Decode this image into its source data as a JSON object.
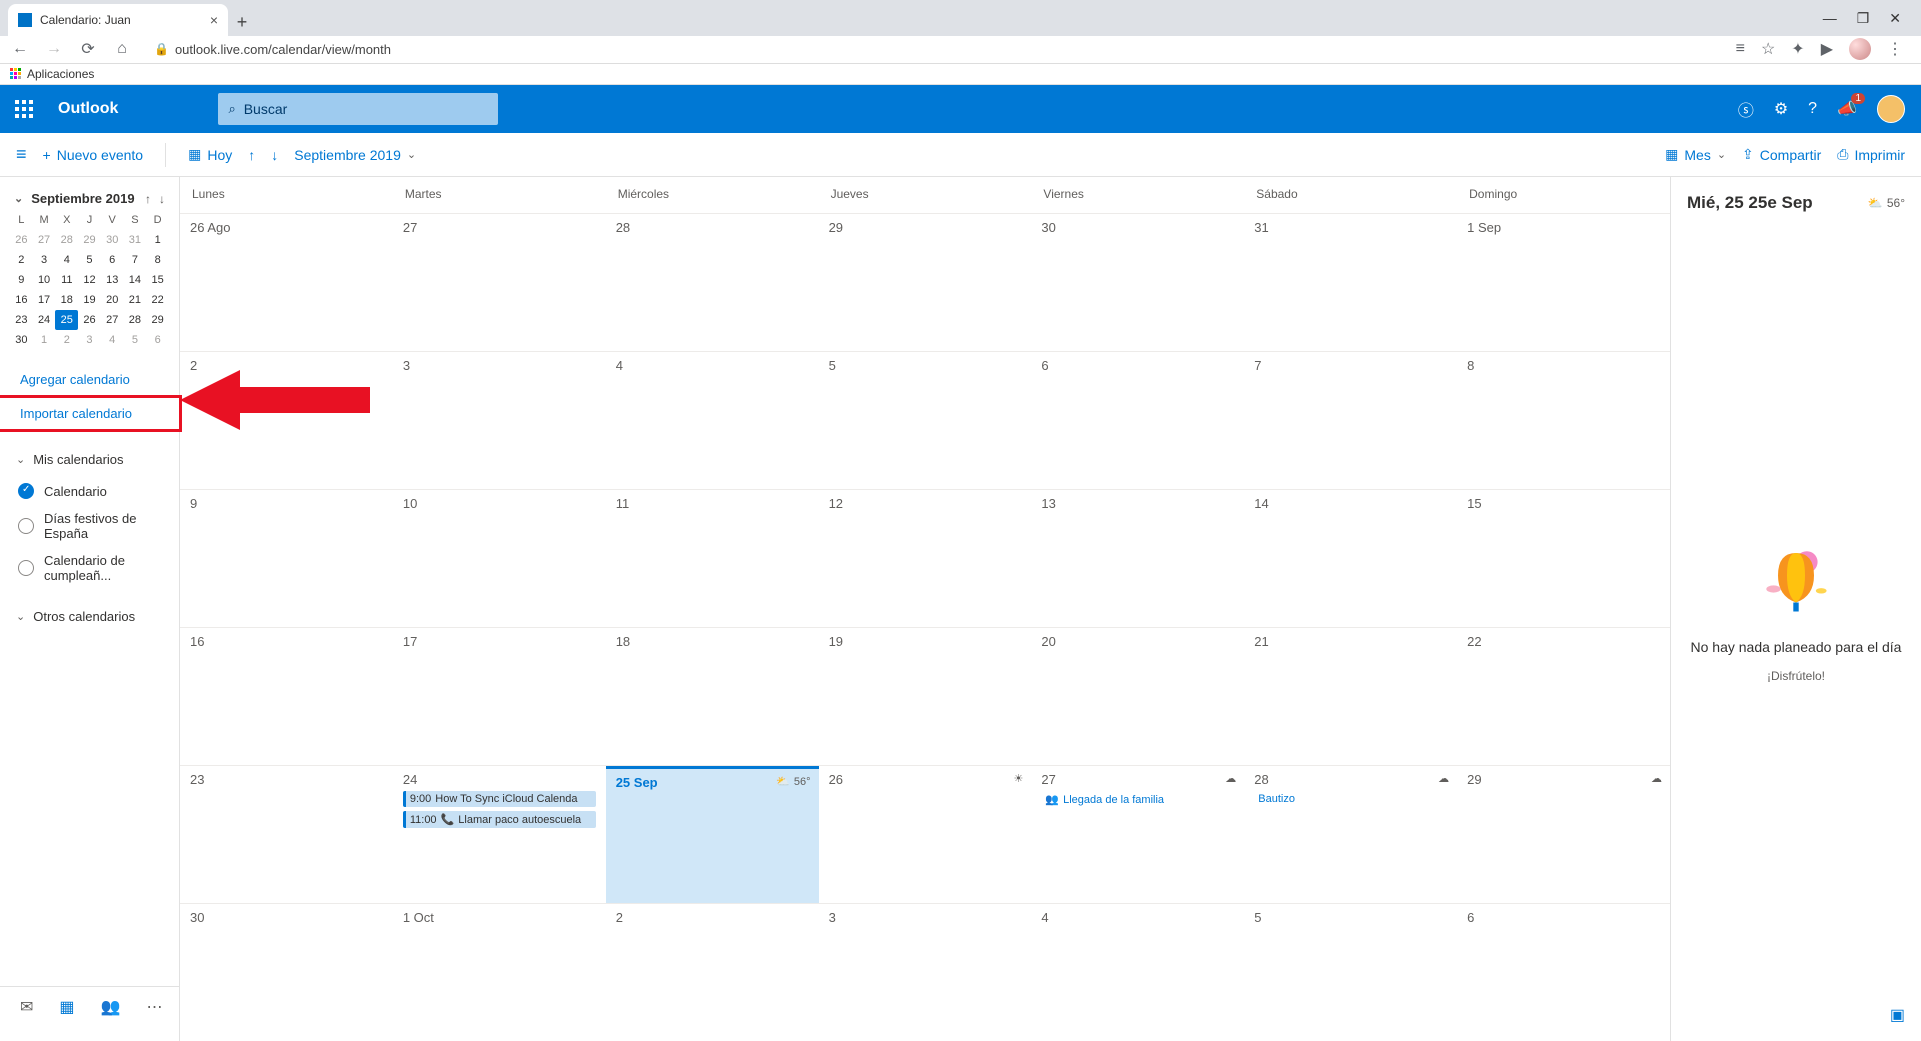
{
  "browser": {
    "tab_title": "Calendario: Juan",
    "url": "outlook.live.com/calendar/view/month",
    "bookmarks_label": "Aplicaciones"
  },
  "header": {
    "brand": "Outlook",
    "search_placeholder": "Buscar",
    "notification_count": "1"
  },
  "toolbar": {
    "new_event": "Nuevo evento",
    "today": "Hoy",
    "month_label": "Septiembre 2019",
    "view_label": "Mes",
    "share": "Compartir",
    "print": "Imprimir"
  },
  "sidebar": {
    "month_label": "Septiembre 2019",
    "day_initials": [
      "L",
      "M",
      "X",
      "J",
      "V",
      "S",
      "D"
    ],
    "mini_rows": [
      [
        "26",
        "27",
        "28",
        "29",
        "30",
        "31",
        "1"
      ],
      [
        "2",
        "3",
        "4",
        "5",
        "6",
        "7",
        "8"
      ],
      [
        "9",
        "10",
        "11",
        "12",
        "13",
        "14",
        "15"
      ],
      [
        "16",
        "17",
        "18",
        "19",
        "20",
        "21",
        "22"
      ],
      [
        "23",
        "24",
        "25",
        "26",
        "27",
        "28",
        "29"
      ],
      [
        "30",
        "1",
        "2",
        "3",
        "4",
        "5",
        "6"
      ]
    ],
    "today_index": [
      4,
      2
    ],
    "muted_first": 6,
    "muted_last_start": 1,
    "add_calendar": "Agregar calendario",
    "import_calendar": "Importar calendario",
    "my_calendars": "Mis calendarios",
    "calendar_items": [
      {
        "label": "Calendario",
        "checked": true
      },
      {
        "label": "Días festivos de España",
        "checked": false
      },
      {
        "label": "Calendario de cumpleañ...",
        "checked": false
      }
    ],
    "other_calendars": "Otros calendarios"
  },
  "calendar": {
    "weekday_labels": [
      "Lunes",
      "Martes",
      "Miércoles",
      "Jueves",
      "Viernes",
      "Sábado",
      "Domingo"
    ],
    "weeks": [
      [
        {
          "d": "26 Ago"
        },
        {
          "d": "27"
        },
        {
          "d": "28"
        },
        {
          "d": "29"
        },
        {
          "d": "30"
        },
        {
          "d": "31"
        },
        {
          "d": "1 Sep"
        }
      ],
      [
        {
          "d": "2"
        },
        {
          "d": "3"
        },
        {
          "d": "4"
        },
        {
          "d": "5"
        },
        {
          "d": "6"
        },
        {
          "d": "7"
        },
        {
          "d": "8"
        }
      ],
      [
        {
          "d": "9"
        },
        {
          "d": "10"
        },
        {
          "d": "11"
        },
        {
          "d": "12"
        },
        {
          "d": "13"
        },
        {
          "d": "14"
        },
        {
          "d": "15"
        }
      ],
      [
        {
          "d": "16"
        },
        {
          "d": "17"
        },
        {
          "d": "18"
        },
        {
          "d": "19"
        },
        {
          "d": "20"
        },
        {
          "d": "21"
        },
        {
          "d": "22"
        }
      ],
      [
        {
          "d": "23"
        },
        {
          "d": "24",
          "events": [
            {
              "time": "9:00",
              "title": "How To Sync iCloud Calenda",
              "type": "blue"
            },
            {
              "time": "11:00",
              "title": "Llamar paco autoescuela",
              "type": "blue",
              "icon": "phone"
            }
          ]
        },
        {
          "d": "25 Sep",
          "today": true,
          "weather": "56°",
          "wicon": "cloud-sun"
        },
        {
          "d": "26",
          "wicon": "sun"
        },
        {
          "d": "27",
          "wicon": "cloud",
          "events": [
            {
              "title": "Llegada de la familia",
              "type": "text",
              "icon": "people"
            }
          ]
        },
        {
          "d": "28",
          "wicon": "cloud",
          "events": [
            {
              "title": "Bautizo",
              "type": "text"
            }
          ]
        },
        {
          "d": "29",
          "wicon": "cloud"
        }
      ],
      [
        {
          "d": "30"
        },
        {
          "d": "1 Oct"
        },
        {
          "d": "2"
        },
        {
          "d": "3"
        },
        {
          "d": "4"
        },
        {
          "d": "5"
        },
        {
          "d": "6"
        }
      ]
    ]
  },
  "right_pane": {
    "date": "Mié, 25 25e Sep",
    "temp": "56°",
    "empty_title": "No hay nada planeado para el día",
    "empty_sub": "¡Disfrútelo!"
  }
}
